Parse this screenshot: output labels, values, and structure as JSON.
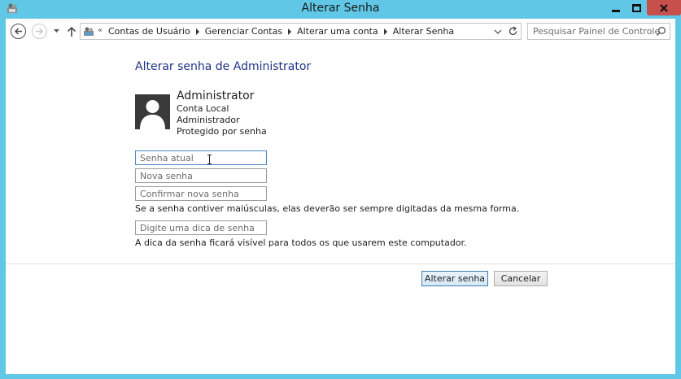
{
  "window": {
    "title": "Alterar Senha"
  },
  "navigation": {
    "breadcrumbs": [
      "Contas de Usuário",
      "Gerenciar Contas",
      "Alterar uma conta",
      "Alterar Senha"
    ],
    "search_placeholder": "Pesquisar Painel de Controle"
  },
  "main": {
    "heading": "Alterar senha de Administrator",
    "account": {
      "name": "Administrator",
      "details": [
        "Conta Local",
        "Administrador",
        "Protegido por senha"
      ]
    },
    "fields": {
      "current_password_placeholder": "Senha atual",
      "new_password_placeholder": "Nova senha",
      "confirm_password_placeholder": "Confirmar nova senha",
      "hint_placeholder": "Digite uma dica de senha"
    },
    "case_note": "Se a senha contiver maiúsculas, elas deverão ser sempre digitadas da mesma forma.",
    "hint_note": "A dica da senha ficará visível para todos os que usarem este computador."
  },
  "actions": {
    "change_label": "Alterar senha",
    "cancel_label": "Cancelar"
  },
  "colors": {
    "frame": "#61c7e6",
    "close_button": "#c7504c",
    "heading": "#1e3287",
    "primary_border": "#3c7fb1"
  }
}
